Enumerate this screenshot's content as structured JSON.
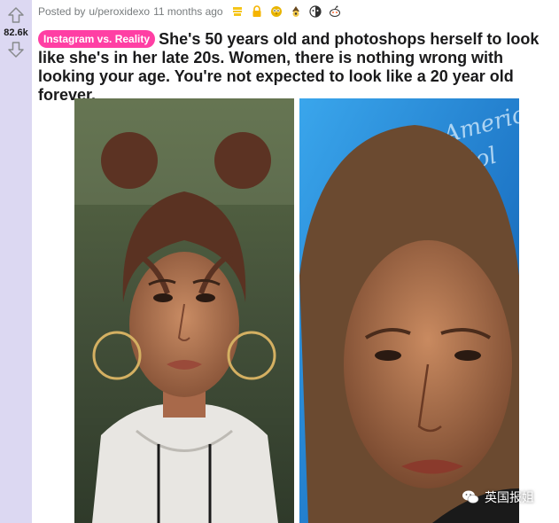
{
  "vote": {
    "score": "82.6k"
  },
  "meta": {
    "posted_by": "Posted by",
    "author": "u/peroxidexo",
    "time_ago": "11 months ago",
    "awards": [
      "bookmark-award-icon",
      "lock-award-icon",
      "owl-award-icon",
      "wizard-award-icon",
      "face-award-icon",
      "reddit-snoo-award-icon"
    ]
  },
  "post": {
    "flair": "Instagram vs. Reality",
    "title": "She's 50 years old and photoshops herself to look like she's in her late 20s. Women, there is nothing wrong with looking your age. You're not expected to look like a 20 year old forever."
  },
  "watermark": {
    "text": "英国报姐"
  },
  "colors": {
    "flair": "#ff3fa4",
    "rail": "#dcd8f2",
    "left_bg": "#4d5a3a",
    "right_bg": "#2a8fdc"
  }
}
